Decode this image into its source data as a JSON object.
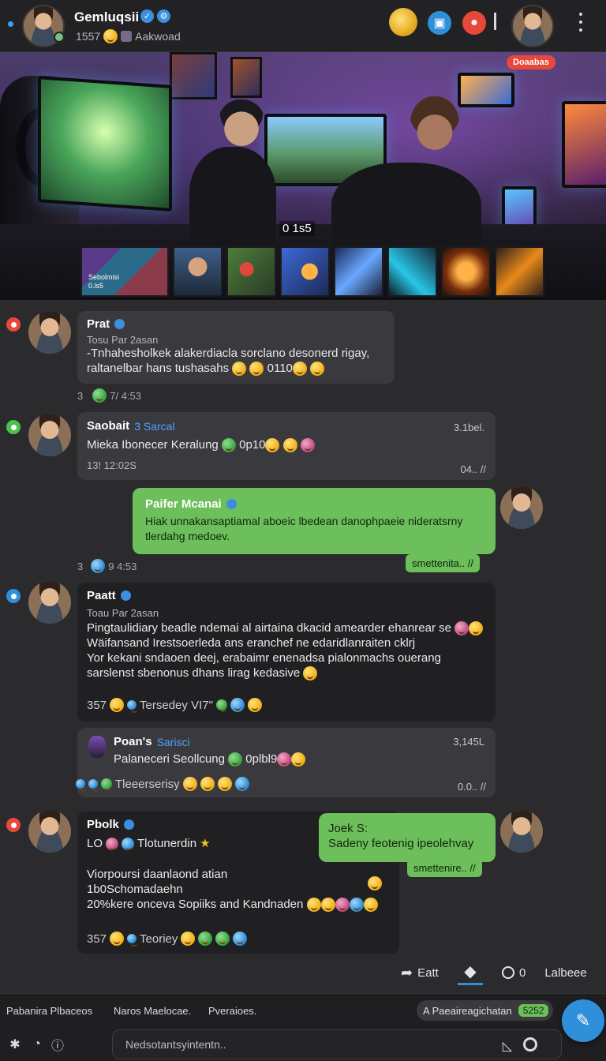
{
  "header": {
    "title": "Gemluqsii",
    "subtitle_count": "1557",
    "subtitle_text": "Aakwoad"
  },
  "hero": {
    "tag": "Doaabas",
    "overlay_text": "0 1s5",
    "thumb_caption_1": "Sebolmisi",
    "thumb_caption_2": "0.ls5"
  },
  "messages": [
    {
      "author": "Prat",
      "subline": "Tosu Par 2asan",
      "text_1": "-Tnhahesholkek alakerdiacla sorclano desonerd rigay,",
      "text_2": "raltanelbar hans tushasahs",
      "text_2_suffix": "0110",
      "meta_count": "3",
      "meta_time": "7/ 4:53"
    },
    {
      "author": "Saobait",
      "tag": "3 Sarcal",
      "time": "3.1bel.",
      "text": "Mieka Ibonecer Keralung",
      "text_suffix": "0p10",
      "meta_time": "13! 12:02S",
      "receipt": "04.. //"
    },
    {
      "author": "Paifer Mcanai",
      "text_1": "Hiak unnakansaptiamal aboeic lbedean danophpaeie nideratsrny",
      "text_2": "tlerdahg medoev.",
      "meta_count": "3",
      "meta_time": "9 4:53",
      "footer": "smettenita.. //"
    },
    {
      "author": "Paatt",
      "subline": "Toau Par 2asan",
      "text_1": "Pingtaulidiary beadle ndemai al airtaina dkacid amearder ehanrear se",
      "text_2": "Wäifansand Irestsoerleda ans eranchef ne edaridlanraiten cklrj",
      "text_3": "Yor kekani sndaoen deej, erabaimr enenadsa pialonmachs ouerang",
      "text_4": "sarslenst sbenonus dhans lirag kedasive",
      "meta_count": "357",
      "meta_text": "Tersedey VI7\""
    },
    {
      "author": "Poan's",
      "tag": "Sarisci",
      "time": "3,145L",
      "text": "Palaneceri Seollcung",
      "text_suffix": "0plbl9",
      "meta_text": "Tleeerserisy",
      "receipt": "0.0.. //"
    },
    {
      "author": "Pbolk",
      "line_2_count": "LO",
      "line_2_text": "Tlotunerdin",
      "text_1": "Viorpoursi daanlaond atian",
      "text_2": "1b0Schomadaehn",
      "text_3": "20%kere onceva Sopiiks and Kandnaden",
      "meta_count": "357",
      "meta_text": "Teoriey"
    },
    {
      "author": "Joek S:",
      "text": "Sadeny feotenig ipeolehvay",
      "footer": "smettenire.. //"
    }
  ],
  "actions": {
    "edit_label": "Eatt",
    "count": "0",
    "label": "Lalbeee"
  },
  "bottom_tabs": {
    "tab_1": "Pabanira Plbaceos",
    "tab_2": "Naros Maelocae.",
    "tab_3": "Pveraioes.",
    "pill_label": "A Paeaireagichatan",
    "pill_count": "5252"
  },
  "composer": {
    "placeholder": "Nedsotantsyintentn.."
  },
  "colors": {
    "accent_blue": "#2f8fd8",
    "accent_green": "#6cbf5a",
    "status_red": "#e8483a",
    "status_green": "#4cc24a"
  }
}
